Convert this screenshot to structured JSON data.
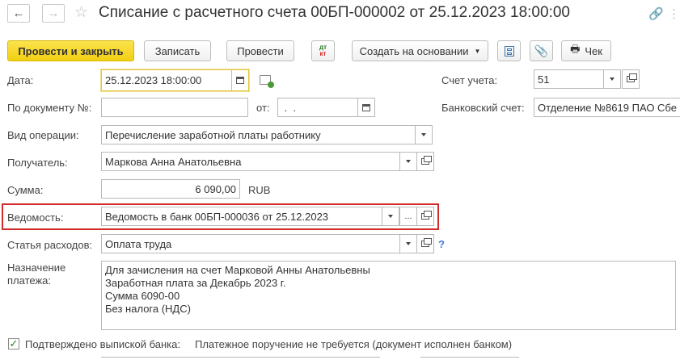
{
  "header": {
    "back_icon": "arrow-left-icon",
    "forward_icon": "arrow-right-icon",
    "title": "Списание с расчетного счета 00БП-000002 от 25.12.2023 18:00:00"
  },
  "toolbar": {
    "post_close_label": "Провести и закрыть",
    "save_label": "Записать",
    "post_label": "Провести",
    "dtkt_label_top": "дт",
    "dtkt_label_bottom": "кт",
    "create_based_label": "Создать на основании",
    "check_label": "Чек",
    "primary_color": "#f4d31c"
  },
  "form": {
    "date_label": "Дата:",
    "date_value": "25.12.2023 18:00:00",
    "doc_num_label": "По документу №:",
    "doc_num_value": "",
    "from_label": "от:",
    "from_value": " .  .",
    "account_label": "Счет учета:",
    "account_value": "51",
    "bank_account_label": "Банковский счет:",
    "bank_account_value": "Отделение №8619 ПАО Сбе",
    "operation_label": "Вид операции:",
    "operation_value": "Перечисление заработной платы работнику",
    "recipient_label": "Получатель:",
    "recipient_value": "Маркова Анна Анатольевна",
    "sum_label": "Сумма:",
    "sum_value": "6 090,00",
    "currency": "RUB",
    "statement_label": "Ведомость:",
    "statement_value": "Ведомость в банк 00БП-000036 от 25.12.2023",
    "expense_label": "Статья расходов:",
    "expense_value": "Оплата труда",
    "help_mark": "?",
    "purpose_label": "Назначение платежа:",
    "purpose_value": "Для зачисления на счет Марковой Анны Анатольевны\nЗаработная плата за Декабрь 2023 г.\nСумма 6090-00\nБез налога (НДС)",
    "confirmed_label": "Подтверждено выпиской банка:",
    "confirmed_checked": true,
    "order_note": "Платежное поручение не требуется (документ исполнен банком)",
    "highlight_color": "#d12b2b"
  }
}
